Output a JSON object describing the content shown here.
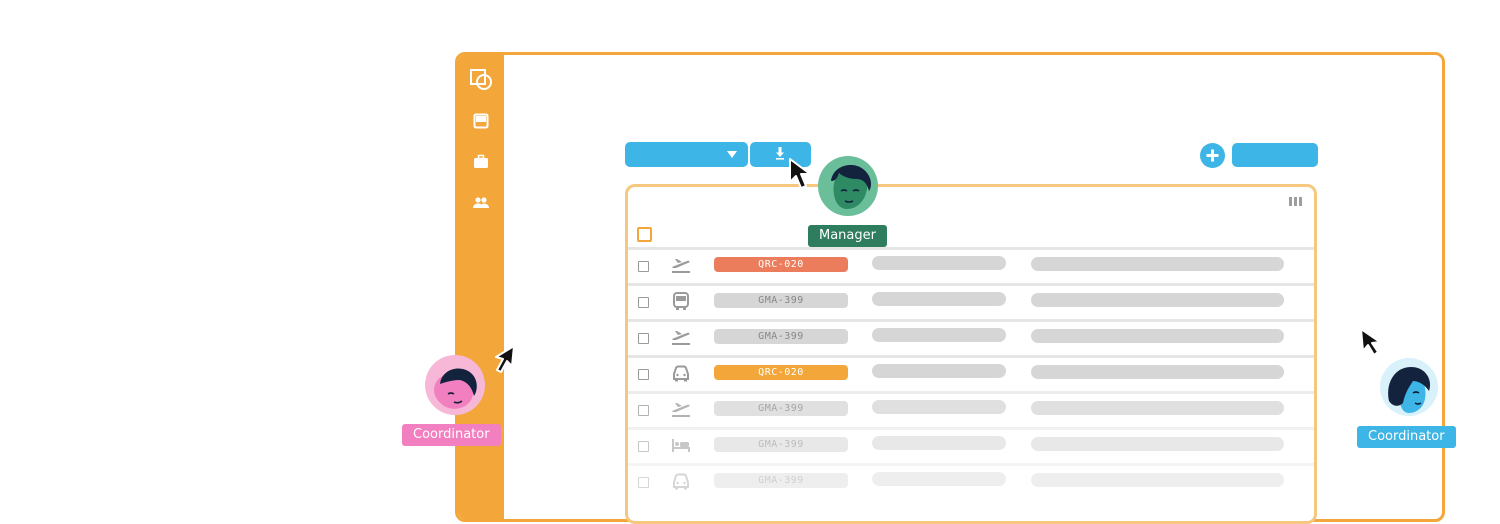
{
  "colors": {
    "accent_orange": "#f3a73b",
    "table_border": "#f6c87f",
    "action_blue": "#3db5e6",
    "manager_green": "#2e7d5f",
    "coordinator_pink": "#f27fbf",
    "tag_red": "#ec7d5c",
    "tag_orange": "#f3a73b"
  },
  "sidebar": {
    "items": [
      {
        "icon": "shapes-icon"
      },
      {
        "icon": "inbox-icon"
      },
      {
        "icon": "briefcase-icon"
      },
      {
        "icon": "users-icon"
      }
    ]
  },
  "toolbar": {
    "dropdown_icon": "caret-down-icon",
    "download_icon": "download-icon",
    "add_icon": "plus-circle-icon"
  },
  "table": {
    "column_toggle_icon": "columns-icon",
    "rows": [
      {
        "type_icon": "plane-departure-icon",
        "code": "QRC-020",
        "highlight": "red"
      },
      {
        "type_icon": "bus-icon",
        "code": "GMA-399",
        "highlight": "none"
      },
      {
        "type_icon": "plane-departure-icon",
        "code": "GMA-399",
        "highlight": "none"
      },
      {
        "type_icon": "car-icon",
        "code": "QRC-020",
        "highlight": "orange"
      },
      {
        "type_icon": "plane-departure-icon",
        "code": "GMA-399",
        "highlight": "none"
      },
      {
        "type_icon": "bed-icon",
        "code": "GMA-399",
        "highlight": "none"
      },
      {
        "type_icon": "car-icon",
        "code": "GMA-399",
        "highlight": "none"
      }
    ]
  },
  "personas": {
    "manager": {
      "label": "Manager"
    },
    "coordinator_left": {
      "label": "Coordinator"
    },
    "coordinator_right": {
      "label": "Coordinator"
    }
  }
}
